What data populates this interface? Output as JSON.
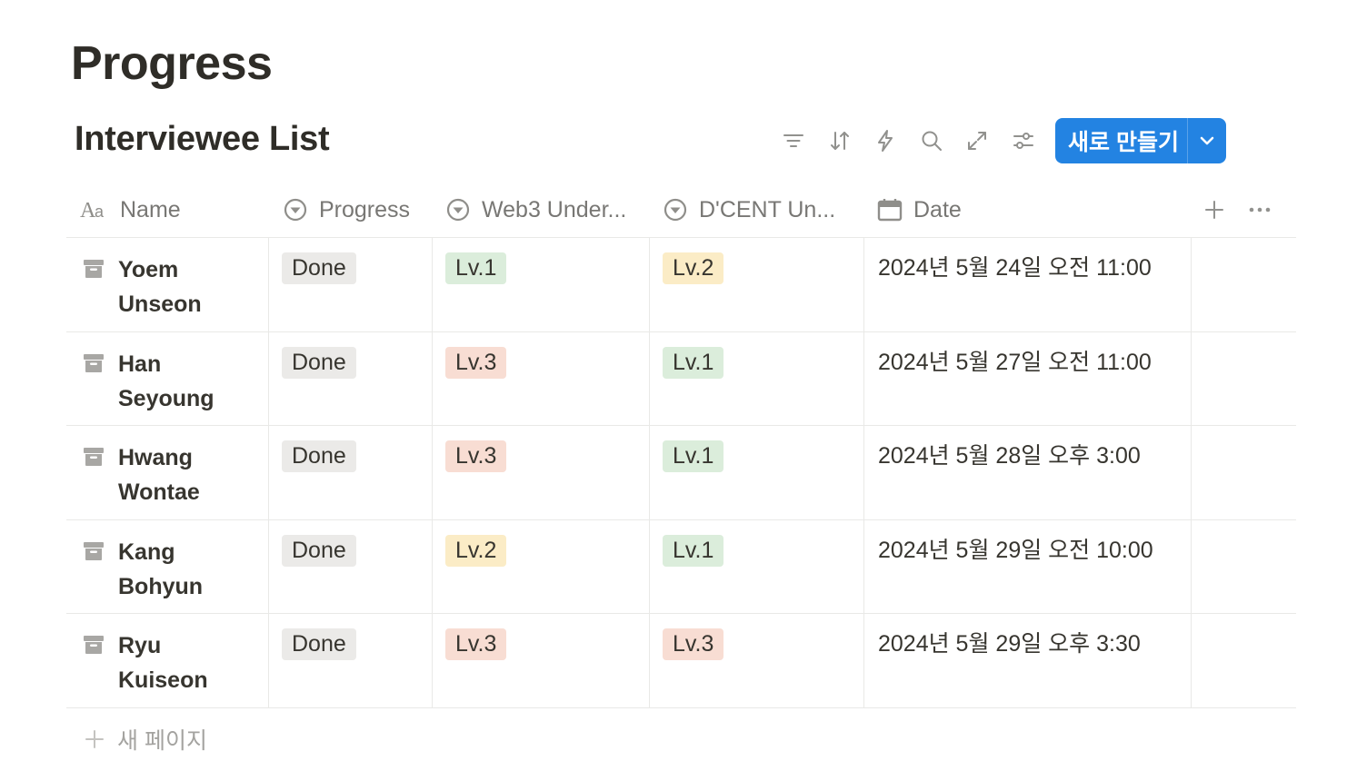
{
  "page": {
    "title": "Progress"
  },
  "database": {
    "title": "Interviewee List",
    "toolbar": {
      "icons": [
        "filter-icon",
        "sort-icon",
        "automation-icon",
        "search-icon",
        "expand-icon",
        "settings-icon"
      ],
      "new_button_label": "새로 만들기"
    },
    "columns": [
      {
        "label": "Name",
        "icon": "text-property-icon"
      },
      {
        "label": "Progress",
        "icon": "select-property-icon"
      },
      {
        "label": "Web3 Under...",
        "icon": "select-property-icon"
      },
      {
        "label": "D'CENT Un...",
        "icon": "select-property-icon"
      },
      {
        "label": "Date",
        "icon": "calendar-icon"
      }
    ],
    "rows": [
      {
        "name_first": "Yoem",
        "name_last": "Unseon",
        "progress": "Done",
        "web3": "Lv.1",
        "web3_color": "#dbeddb",
        "dcent": "Lv.2",
        "dcent_color": "#fbecc6",
        "date": "2024년 5월 24일 오전 11:00"
      },
      {
        "name_first": "Han",
        "name_last": "Seyoung",
        "progress": "Done",
        "web3": "Lv.3",
        "web3_color": "#f8ddd3",
        "dcent": "Lv.1",
        "dcent_color": "#dbeddb",
        "date": "2024년 5월 27일 오전 11:00"
      },
      {
        "name_first": "Hwang",
        "name_last": "Wontae",
        "progress": "Done",
        "web3": "Lv.3",
        "web3_color": "#f8ddd3",
        "dcent": "Lv.1",
        "dcent_color": "#dbeddb",
        "date": "2024년 5월 28일 오후 3:00"
      },
      {
        "name_first": "Kang",
        "name_last": "Bohyun",
        "progress": "Done",
        "web3": "Lv.2",
        "web3_color": "#fbecc6",
        "dcent": "Lv.1",
        "dcent_color": "#dbeddb",
        "date": "2024년 5월 29일 오전 10:00"
      },
      {
        "name_first": "Ryu",
        "name_last": "Kuiseon",
        "progress": "Done",
        "web3": "Lv.3",
        "web3_color": "#f8ddd3",
        "dcent": "Lv.3",
        "dcent_color": "#f8ddd3",
        "date": "2024년 5월 29일 오후 3:30"
      }
    ],
    "progress_tag_color": "#ebeae8",
    "new_page_label": "새 페이지"
  },
  "colors": {
    "accent": "#2383e2",
    "text": "#37352f",
    "muted": "#787774",
    "border": "#e9e9e7"
  }
}
